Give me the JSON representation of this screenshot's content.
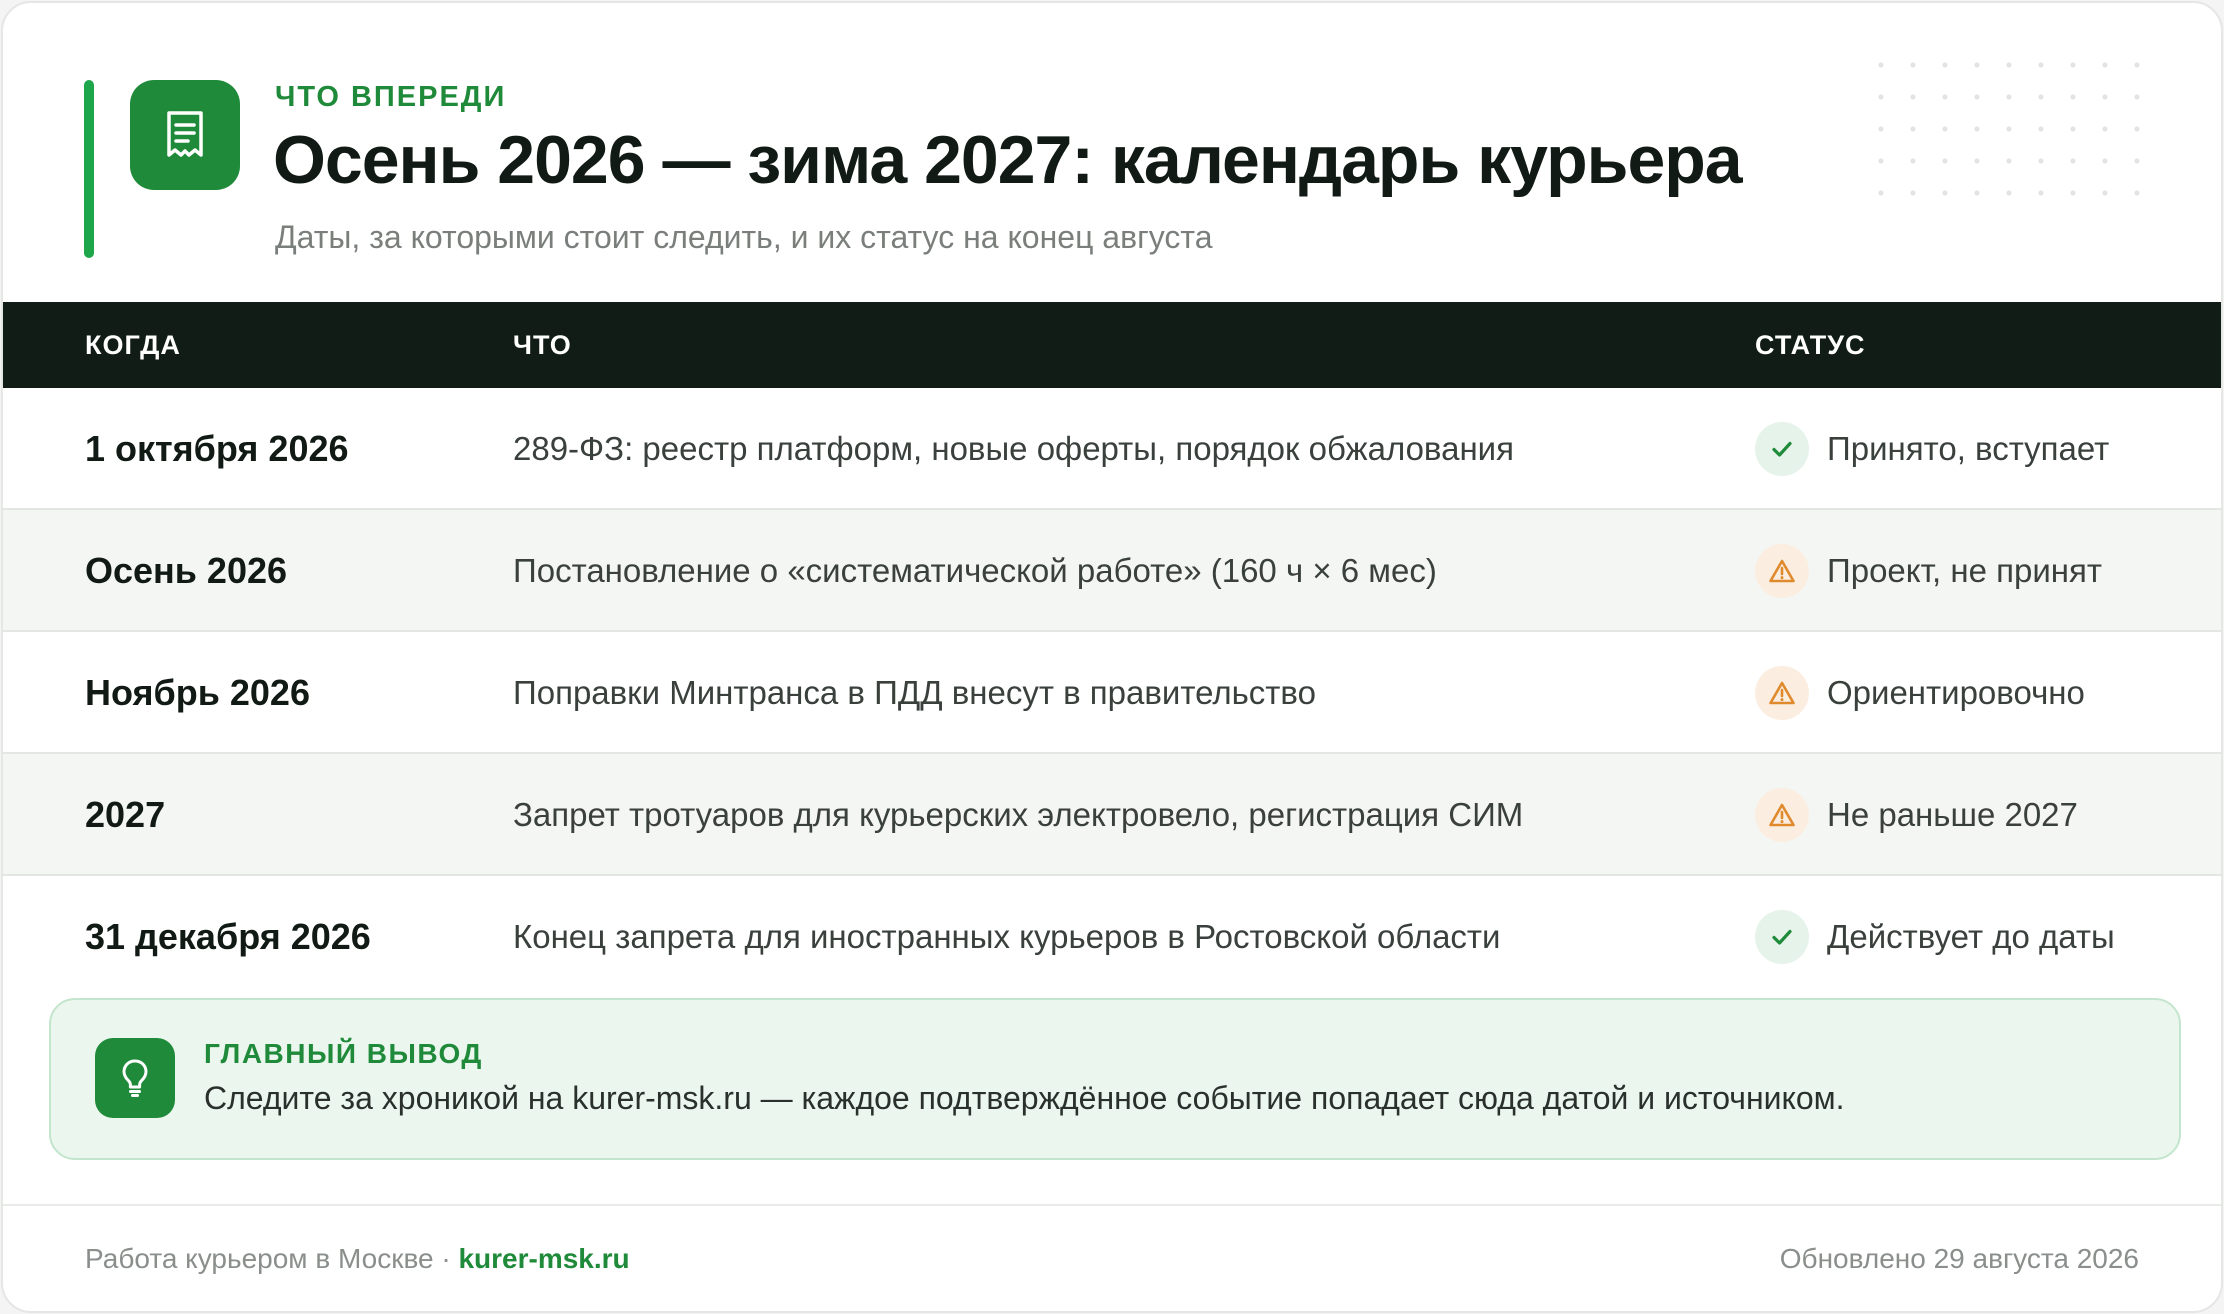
{
  "header": {
    "eyebrow": "Что впереди",
    "title": "Осень 2026 — зима 2027: календарь курьера",
    "subtitle": "Даты, за которыми стоит следить, и их статус на конец августа",
    "icon": "receipt-icon"
  },
  "table": {
    "columns": {
      "when": "Когда",
      "what": "Что",
      "status": "Статус"
    },
    "rows": [
      {
        "when": "1 октября 2026",
        "what": "289-ФЗ: реестр платформ, новые оферты, порядок обжалования",
        "status": "Принято, вступает",
        "status_kind": "ok"
      },
      {
        "when": "Осень 2026",
        "what": "Постановление о «систематической работе» (160 ч × 6 мес)",
        "status": "Проект, не принят",
        "status_kind": "warn"
      },
      {
        "when": "Ноябрь 2026",
        "what": "Поправки Минтранса в ПДД внесут в правительство",
        "status": "Ориентировочно",
        "status_kind": "warn"
      },
      {
        "when": "2027",
        "what": "Запрет тротуаров для курьерских электровело, регистрация СИМ",
        "status": "Не раньше 2027",
        "status_kind": "warn"
      },
      {
        "when": "31 декабря 2026",
        "what": "Конец запрета для иностранных курьеров в Ростовской области",
        "status": "Действует до даты",
        "status_kind": "ok"
      }
    ]
  },
  "takeaway": {
    "label": "Главный вывод",
    "text": "Следите за хроникой на kurer-msk.ru — каждое подтверждённое событие попадает сюда датой и источником.",
    "icon": "lightbulb-icon"
  },
  "footer": {
    "site_name": "Работа курьером в Москве",
    "separator": " · ",
    "brand": "kurer-msk.ru",
    "updated": "Обновлено 29 августа 2026"
  },
  "colors": {
    "brand_green": "#1f8a3a",
    "accent_green": "#1ea64b",
    "header_dark": "#111c16",
    "warn_orange": "#e08a2e"
  }
}
